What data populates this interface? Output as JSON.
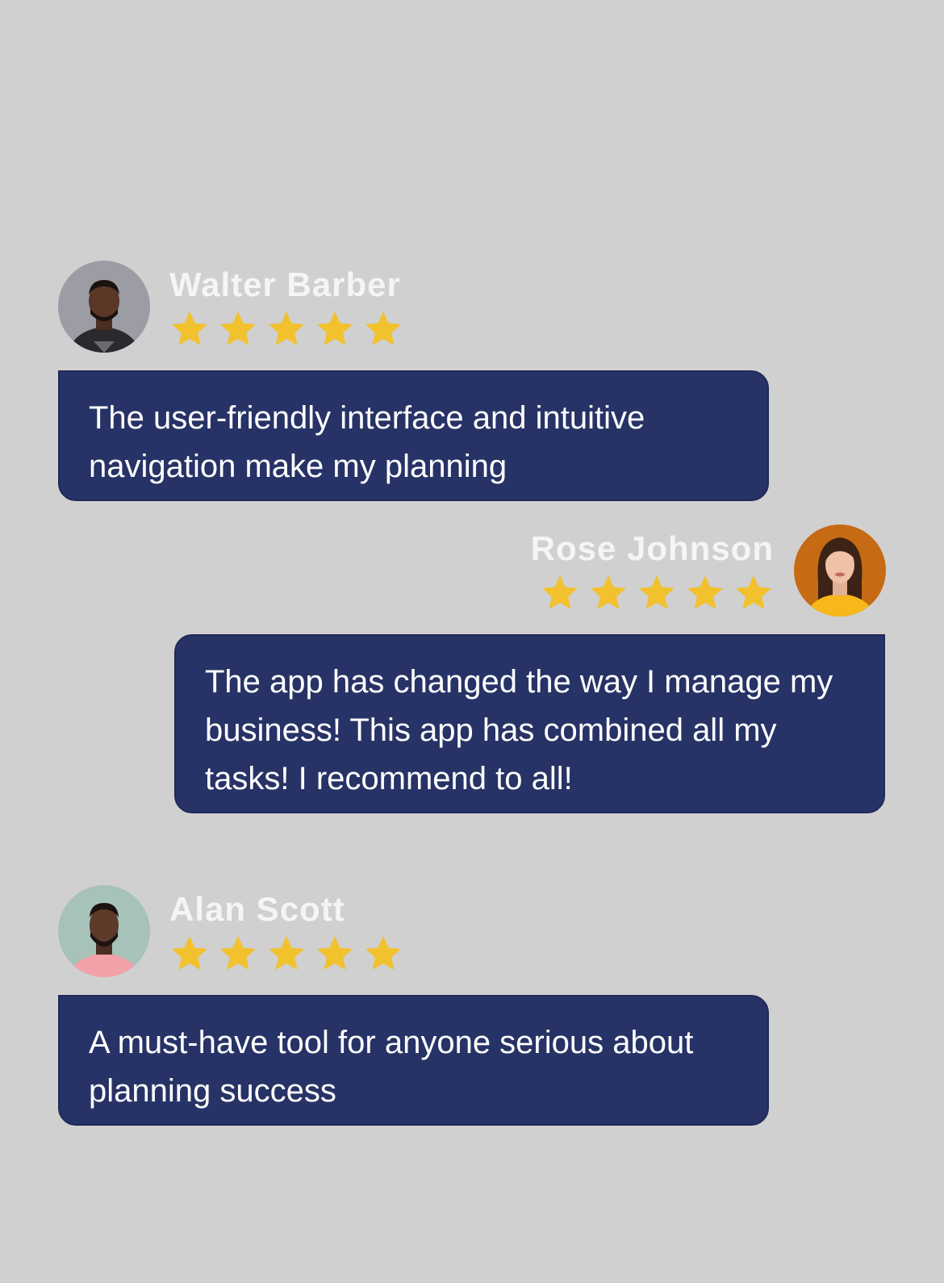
{
  "colors": {
    "background": "#d0d0d0",
    "bubble": "#273366",
    "star": "#f2c12e",
    "name_text": "#f5f5f5"
  },
  "reviews": [
    {
      "name": "Walter Barber",
      "rating": 5,
      "max_rating": 5,
      "text": "The user-friendly interface and intuitive navigation make my planning",
      "align": "left",
      "avatar_icon": "man-portrait-avatar"
    },
    {
      "name": "Rose Johnson",
      "rating": 5,
      "max_rating": 5,
      "text": "The app has changed the way I manage my business! This app has combined all my tasks! I recommend to all!",
      "align": "right",
      "avatar_icon": "woman-portrait-avatar"
    },
    {
      "name": "Alan Scott",
      "rating": 5,
      "max_rating": 5,
      "text": "A must-have tool for anyone serious about planning success",
      "align": "left",
      "avatar_icon": "man-portrait-avatar"
    }
  ]
}
